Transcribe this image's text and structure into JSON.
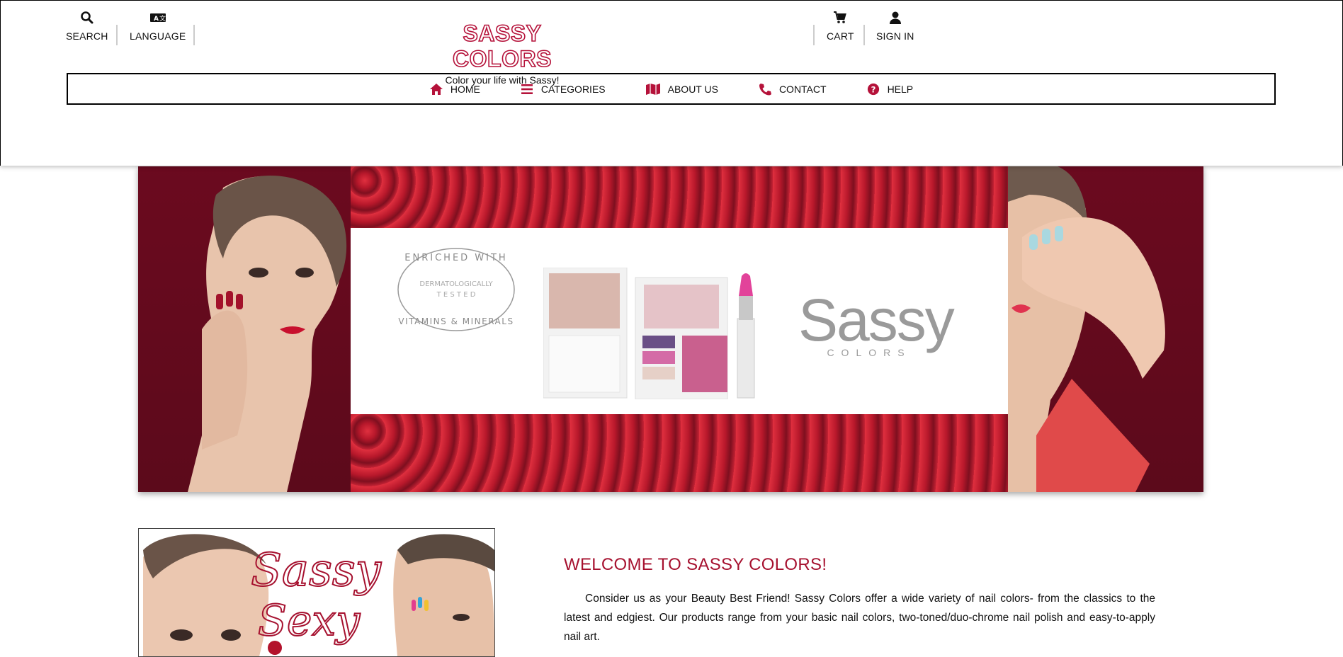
{
  "header": {
    "search_label": "SEARCH",
    "language_label": "LANGUAGE",
    "cart_label": "CART",
    "signin_label": "SIGN IN",
    "logo_text": "SASSY COLORS",
    "tagline": "Color your life with Sassy!"
  },
  "nav": {
    "items": [
      {
        "label": "HOME",
        "icon": "home-icon"
      },
      {
        "label": "CATEGORIES",
        "icon": "list-icon"
      },
      {
        "label": "ABOUT US",
        "icon": "map-icon"
      },
      {
        "label": "CONTACT",
        "icon": "phone-icon"
      },
      {
        "label": "HELP",
        "icon": "question-icon"
      }
    ]
  },
  "banner": {
    "seal_top": "ENRICHED WITH",
    "seal_middle": "DERMATOLOGICALLY",
    "seal_middle2": "T E S T E D",
    "seal_bottom": "VITAMINS & MINERALS",
    "brand_big": "Sassy",
    "brand_small": "COLORS"
  },
  "promo": {
    "script_line1": "Sassy",
    "script_line2": "Sexy"
  },
  "welcome": {
    "title": "WELCOME TO SASSY COLORS!",
    "text": "Consider us as your Beauty Best Friend! Sassy Colors offer a wide variety of nail colors- from the classics to the latest and edgiest. Our products range from your basic nail colors, two-toned/duo-chrome nail polish and easy-to-apply nail art."
  },
  "colors": {
    "brand": "#c8143f",
    "title": "#a6112f",
    "banner_bg": "#6b0a1f"
  }
}
